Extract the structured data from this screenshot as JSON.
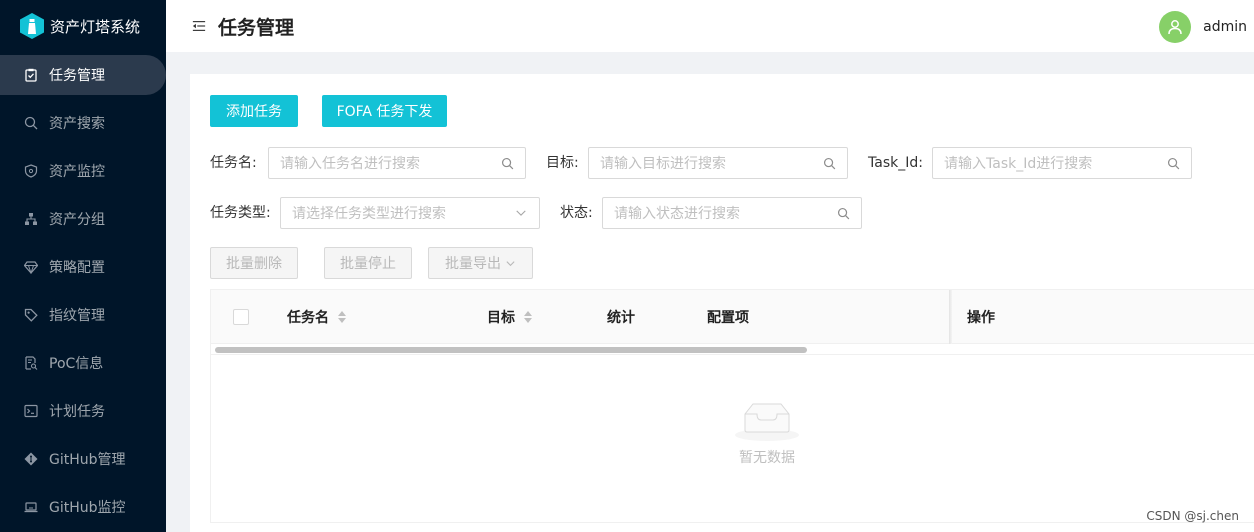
{
  "app": {
    "title": "资产灯塔系统"
  },
  "sidebar": {
    "items": [
      {
        "label": "任务管理",
        "icon": "clipboard-check-icon",
        "active": true
      },
      {
        "label": "资产搜索",
        "icon": "search-icon",
        "active": false
      },
      {
        "label": "资产监控",
        "icon": "shield-icon",
        "active": false
      },
      {
        "label": "资产分组",
        "icon": "cluster-icon",
        "active": false
      },
      {
        "label": "策略配置",
        "icon": "gem-icon",
        "active": false
      },
      {
        "label": "指纹管理",
        "icon": "tag-icon",
        "active": false
      },
      {
        "label": "PoC信息",
        "icon": "file-search-icon",
        "active": false
      },
      {
        "label": "计划任务",
        "icon": "terminal-icon",
        "active": false
      },
      {
        "label": "GitHub管理",
        "icon": "github-diamond-icon",
        "active": false
      },
      {
        "label": "GitHub监控",
        "icon": "laptop-icon",
        "active": false
      }
    ]
  },
  "header": {
    "title": "任务管理",
    "username": "admin"
  },
  "toolbar": {
    "add_task": "添加任务",
    "fofa_task": "FOFA 任务下发"
  },
  "filters": {
    "task_name": {
      "label": "任务名:",
      "placeholder": "请输入任务名进行搜索"
    },
    "target": {
      "label": "目标:",
      "placeholder": "请输入目标进行搜索"
    },
    "task_id": {
      "label": "Task_Id:",
      "placeholder": "请输入Task_Id进行搜索"
    },
    "task_type": {
      "label": "任务类型:",
      "placeholder": "请选择任务类型进行搜索"
    },
    "status": {
      "label": "状态:",
      "placeholder": "请输入状态进行搜索"
    }
  },
  "batch": {
    "delete": "批量删除",
    "stop": "批量停止",
    "export": "批量导出"
  },
  "table": {
    "columns": [
      "任务名",
      "目标",
      "统计",
      "配置项",
      "操作"
    ],
    "empty_text": "暂无数据"
  },
  "watermark": "CSDN @sj.chen",
  "colors": {
    "primary": "#13c2d6",
    "sidebar_bg": "#001529",
    "avatar_bg": "#87d068"
  }
}
